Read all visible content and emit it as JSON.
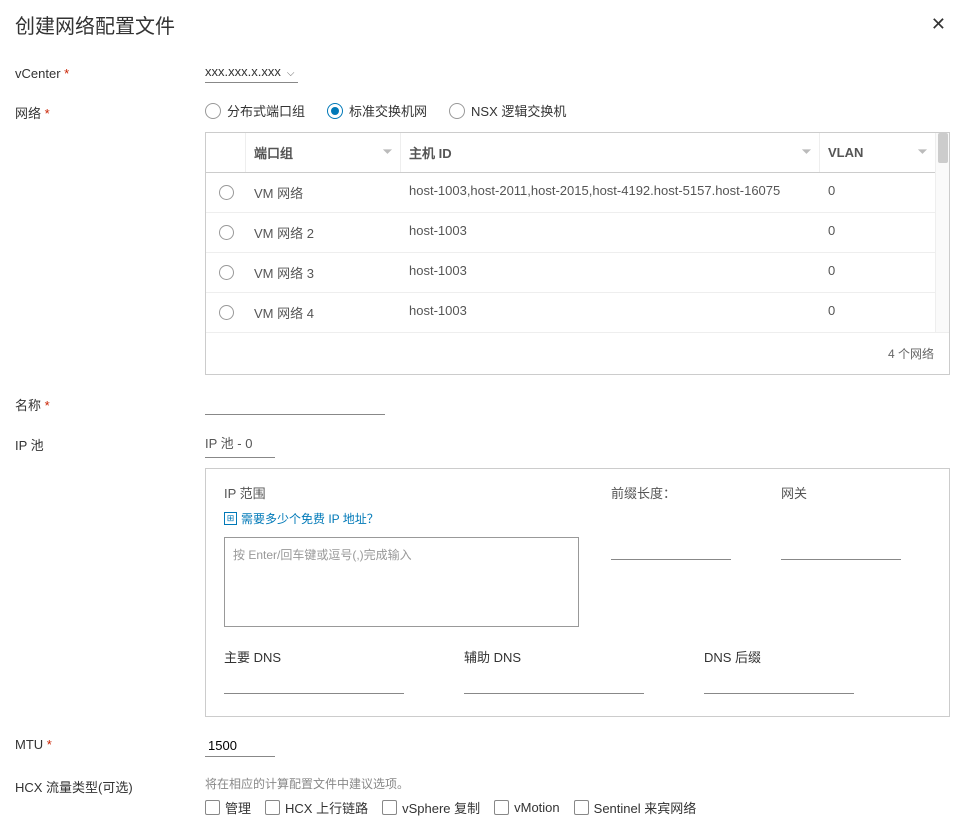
{
  "dialog": {
    "title": "创建网络配置文件"
  },
  "fields": {
    "vcenter": {
      "label": "vCenter",
      "value": "xxx.xxx.x.xxx"
    },
    "network": {
      "label": "网络",
      "options": {
        "distributed": "分布式端口组",
        "standard": "标准交换机网",
        "nsx": "NSX 逻辑交换机"
      }
    },
    "name": {
      "label": "名称"
    },
    "ip_pool": {
      "label": "IP 池",
      "title": "IP 池 - 0"
    },
    "mtu": {
      "label": "MTU",
      "value": "1500"
    },
    "hcx_traffic": {
      "label": "HCX 流量类型(可选)",
      "hint": "将在相应的计算配置文件中建议选项。",
      "options": {
        "mgmt": "管理",
        "uplink": "HCX 上行链路",
        "vsphere": "vSphere 复制",
        "vmotion": "vMotion",
        "sentinel": "Sentinel 来宾网络"
      }
    }
  },
  "table": {
    "headers": {
      "port_group": "端口组",
      "host_id": "主机 ID",
      "vlan": "VLAN"
    },
    "rows": [
      {
        "port_group": "VM 网络",
        "host_id": "host-1003,host-2011,host-2015,host-4192.host-5157.host-16075",
        "vlan": "0"
      },
      {
        "port_group": "VM 网络 2",
        "host_id": "host-1003",
        "vlan": "0"
      },
      {
        "port_group": "VM 网络 3",
        "host_id": "host-1003",
        "vlan": "0"
      },
      {
        "port_group": "VM 网络 4",
        "host_id": "host-1003",
        "vlan": "0"
      }
    ],
    "footer": "4 个网络"
  },
  "ip_box": {
    "range_label": "IP 范围",
    "prefix_label": "前缀长度：",
    "gateway_label": "网关",
    "help_link": "需要多少个免费 IP 地址？",
    "textarea_placeholder": "按 Enter/回车键或逗号(,)完成输入",
    "primary_dns": "主要 DNS",
    "secondary_dns": "辅助 DNS",
    "dns_suffix": "DNS 后缀"
  }
}
